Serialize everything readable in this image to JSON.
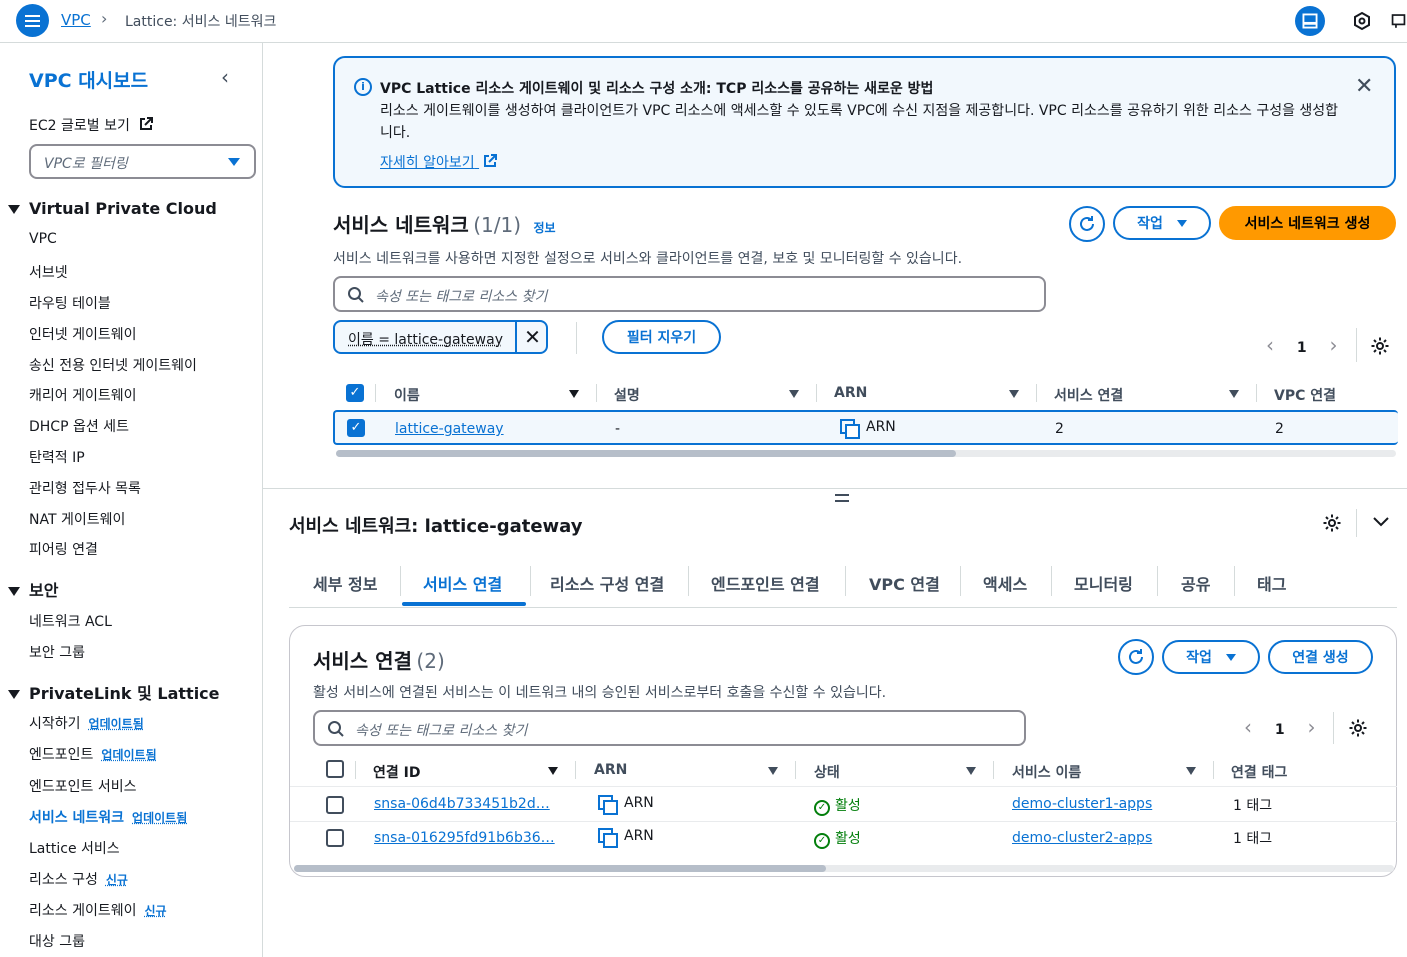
{
  "breadcrumb": {
    "root": "VPC",
    "current": "Lattice: 서비스 네트워크"
  },
  "sidebar": {
    "title": "VPC 대시보드",
    "ec2_link": "EC2 글로벌 보기",
    "filter_placeholder": "VPC로 필터링",
    "sections": [
      {
        "label": "Virtual Private Cloud",
        "items": [
          "VPC",
          "서브넷",
          "라우팅 테이블",
          "인터넷 게이트웨이",
          "송신 전용 인터넷 게이트웨이",
          "캐리어 게이트웨이",
          "DHCP 옵션 세트",
          "탄력적 IP",
          "관리형 접두사 목록",
          "NAT 게이트웨이",
          "피어링 연결"
        ]
      },
      {
        "label": "보안",
        "items": [
          "네트워크 ACL",
          "보안 그룹"
        ]
      },
      {
        "label": "PrivateLink 및 Lattice",
        "items": [
          "시작하기",
          "엔드포인트",
          "엔드포인트 서비스",
          "서비스 네트워크",
          "Lattice 서비스",
          "리소스 구성",
          "리소스 게이트웨이",
          "대상 그룹"
        ]
      }
    ],
    "badges": {
      "updated": "업데이트됨",
      "new": "신규"
    }
  },
  "flash": {
    "title": "VPC Lattice 리소스 게이트웨이 및 리소스 구성 소개: TCP 리소스를 공유하는 새로운 방법",
    "body": "리소스 게이트웨이를 생성하여 클라이언트가 VPC 리소스에 액세스할 수 있도록 VPC에 수신 지점을 제공합니다. VPC 리소스를 공유하기 위한 리소스 구성을 생성합니다.",
    "link": "자세히 알아보기"
  },
  "networks": {
    "title": "서비스 네트워크",
    "count": "(1/1)",
    "info": "정보",
    "actions": "작업",
    "create": "서비스 네트워크 생성",
    "description": "서비스 네트워크를 사용하면 지정한 설정으로 서비스와 클라이언트를 연결, 보호 및 모니터링할 수 있습니다.",
    "search_placeholder": "속성 또는 태그로 리소스 찾기",
    "token": "이름 = lattice-gateway",
    "clear_filters": "필터 지우기",
    "page": "1",
    "columns": [
      "이름",
      "설명",
      "ARN",
      "서비스 연결",
      "VPC 연결"
    ],
    "rows": [
      {
        "name": "lattice-gateway",
        "description": "-",
        "arn": "ARN",
        "service_assoc": "2",
        "vpc_assoc": "2"
      }
    ]
  },
  "detail": {
    "title": "서비스 네트워크: lattice-gateway",
    "tabs": [
      "세부 정보",
      "서비스 연결",
      "리소스 구성 연결",
      "엔드포인트 연결",
      "VPC 연결",
      "액세스",
      "모니터링",
      "공유",
      "태그"
    ],
    "active_tab": "서비스 연결"
  },
  "associations": {
    "title": "서비스 연결",
    "count": "(2)",
    "actions": "작업",
    "create": "연결 생성",
    "description": "활성 서비스에 연결된 서비스는 이 네트워크 내의 승인된 서비스로부터 호출을 수신할 수 있습니다.",
    "search_placeholder": "속성 또는 태그로 리소스 찾기",
    "page": "1",
    "columns": [
      "연결 ID",
      "ARN",
      "상태",
      "서비스 이름",
      "연결 태그"
    ],
    "rows": [
      {
        "id": "snsa-06d4b733451b2d…",
        "arn": "ARN",
        "status": "활성",
        "service": "demo-cluster1-apps",
        "tags": "1 태그"
      },
      {
        "id": "snsa-016295fd91b6b36…",
        "arn": "ARN",
        "status": "활성",
        "service": "demo-cluster2-apps",
        "tags": "1 태그"
      }
    ]
  }
}
